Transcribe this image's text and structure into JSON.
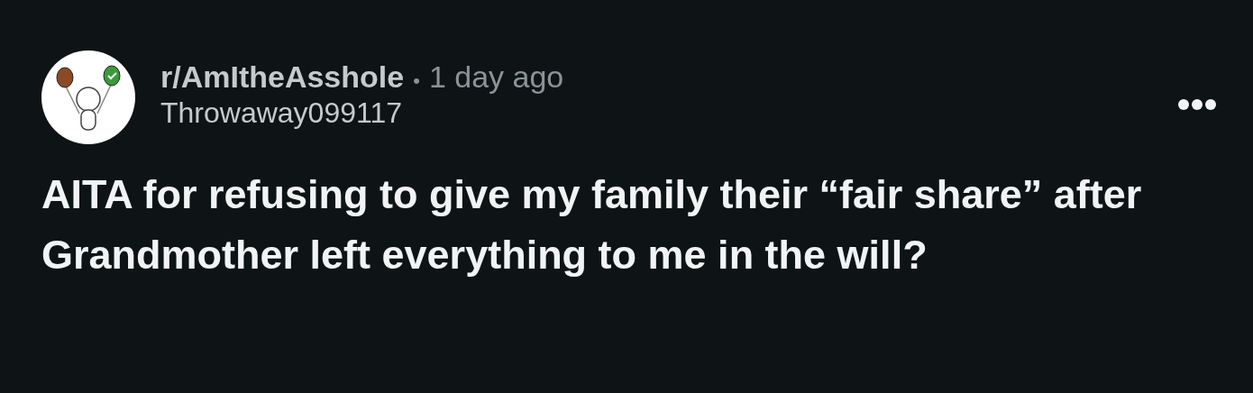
{
  "post": {
    "subreddit": "r/AmItheAsshole",
    "separator": "•",
    "time": "1 day ago",
    "author": "Throwaway099117",
    "title": "AITA for refusing to give my family their “fair share” after Grandmother left everything to me in the will?"
  }
}
